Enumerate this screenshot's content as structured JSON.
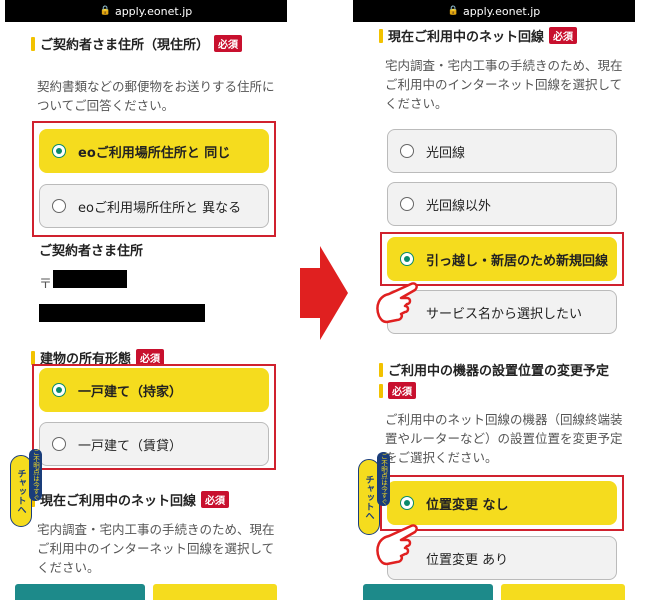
{
  "url": "apply.eonet.jp",
  "left": {
    "section1_title": "ご契約者さま住所（現住所）",
    "required": "必須",
    "section1_desc": "契約書類などの郵便物をお送りする住所についてご回答ください。",
    "section1_options": [
      "eoご利用場所住所と 同じ",
      "eoご利用場所住所と 異なる"
    ],
    "address_label": "ご契約者さま住所",
    "postal_mark": "〒",
    "section2_title": "建物の所有形態",
    "section2_options": [
      "一戸建て（持家）",
      "一戸建て（賃貸）"
    ],
    "section3_title": "現在ご利用中のネット回線",
    "section3_desc": "宅内調査・宅内工事の手続きのため、現在ご利用中のインターネット回線を選択してください。",
    "chat_label": "チャットへ",
    "chat_sub": "ご不明点は今すぐ"
  },
  "right": {
    "section1_title": "現在ご利用中のネット回線",
    "required": "必須",
    "section1_desc": "宅内調査・宅内工事の手続きのため、現在ご利用中のインターネット回線を選択してください。",
    "section1_options": [
      "光回線",
      "光回線以外",
      "引っ越し・新居のため新規回線",
      "サービス名から選択したい"
    ],
    "section2_title": "ご利用中の機器の設置位置の変更予定",
    "section2_desc": "ご利用中のネット回線の機器（回線終端装置やルーターなど）の設置位置を変更予定をご選択ください。",
    "section2_options": [
      "位置変更 なし",
      "位置変更 あり"
    ],
    "chat_label": "チャットへ",
    "chat_sub": "ご不明点は今すぐ"
  },
  "colors": {
    "accent_yellow": "#f5dc1e",
    "required_red": "#c8102e",
    "highlight_red": "#d0212e",
    "arrow_red": "#e02020",
    "radio_green": "#0a8a6a"
  }
}
